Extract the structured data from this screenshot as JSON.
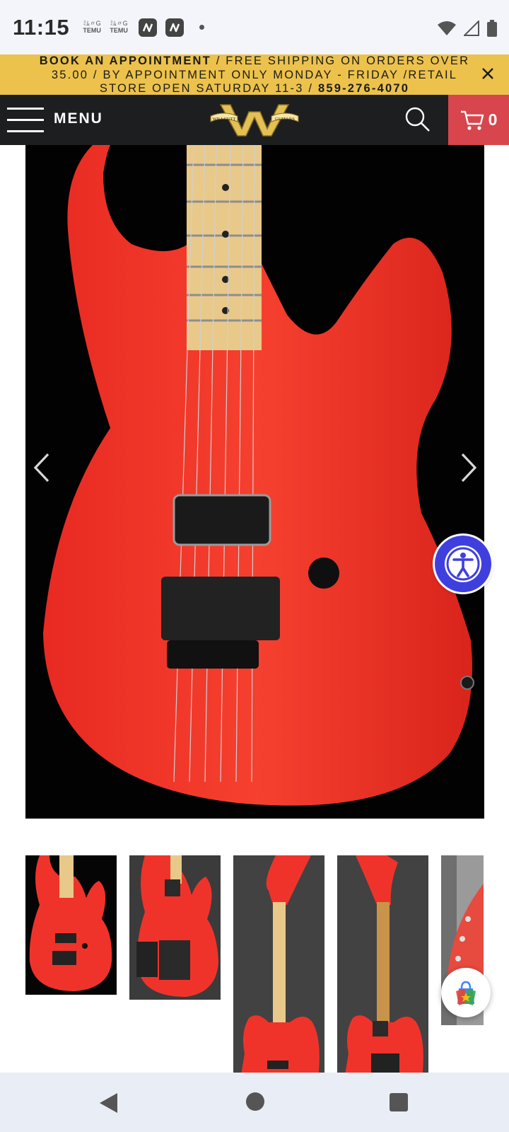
{
  "status_bar": {
    "time": "11:15",
    "notif_app_1": {
      "glyphs": "ﾐﾑ〃G",
      "name": "TEMU"
    },
    "notif_app_2": {
      "glyphs": "ﾐﾑ〃G",
      "name": "TEMU"
    },
    "icons": [
      "temu-icon",
      "temu-icon",
      "app-icon",
      "app-icon",
      "dot",
      "wifi-icon",
      "signal-icon",
      "battery-icon"
    ]
  },
  "promo": {
    "book": "BOOK AN APPOINTMENT",
    "middle": " / FREE SHIPPING ON ORDERS OVER 35.00 / BY APPOINTMENT ONLY MONDAY - FRIDAY /RETAIL STORE OPEN SATURDAY 11-3 / ",
    "phone": "859-276-4070",
    "close_icon": "close-icon"
  },
  "nav": {
    "menu_label": "MENU",
    "logo_text_left": "WILLCUTT",
    "logo_text_right": "GUITARS",
    "cart_count": "0"
  },
  "colors": {
    "promo_bg": "#ecc24c",
    "nav_bg": "#1d1e20",
    "cart_bg": "#d8454d",
    "guitar_red": "#f0332a",
    "a11y_blue": "#3f3fe0"
  },
  "gallery": {
    "thumbnails": [
      "front",
      "back",
      "full-front",
      "full-back",
      "headstock"
    ]
  }
}
